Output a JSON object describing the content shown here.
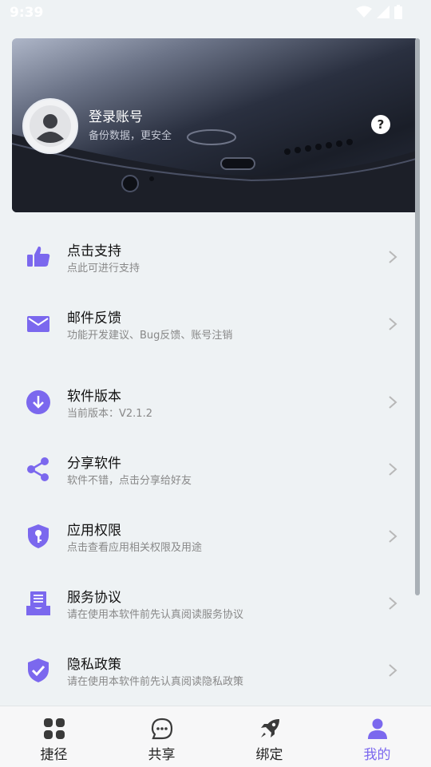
{
  "status_bar": {
    "time": "9:39"
  },
  "profile": {
    "title": "登录账号",
    "subtitle": "备份数据，更安全",
    "help_glyph": "?"
  },
  "menu": [
    {
      "id": "support",
      "title": "点击支持",
      "subtitle": "点此可进行支持",
      "icon": "thumbs-up-icon"
    },
    {
      "id": "feedback",
      "title": "邮件反馈",
      "subtitle": "功能开发建议、Bug反馈、账号注销",
      "icon": "mail-icon"
    },
    {
      "id": "version",
      "title": "软件版本",
      "subtitle": "当前版本：V2.1.2",
      "icon": "download-icon"
    },
    {
      "id": "share",
      "title": "分享软件",
      "subtitle": "软件不错，点击分享给好友",
      "icon": "share-icon"
    },
    {
      "id": "permissions",
      "title": "应用权限",
      "subtitle": "点击查看应用相关权限及用途",
      "icon": "shield-key-icon"
    },
    {
      "id": "agreement",
      "title": "服务协议",
      "subtitle": "请在使用本软件前先认真阅读服务协议",
      "icon": "document-icon"
    },
    {
      "id": "privacy",
      "title": "隐私政策",
      "subtitle": "请在使用本软件前先认真阅读隐私政策",
      "icon": "shield-check-icon"
    }
  ],
  "bottom_nav": [
    {
      "label": "捷径",
      "icon": "grid-icon",
      "active": false
    },
    {
      "label": "共享",
      "icon": "chat-icon",
      "active": false
    },
    {
      "label": "绑定",
      "icon": "rocket-icon",
      "active": false
    },
    {
      "label": "我的",
      "icon": "person-icon",
      "active": true
    }
  ],
  "colors": {
    "accent": "#7b68ee",
    "background": "#eef2f4",
    "nav_inactive": "#3a3a3a"
  }
}
